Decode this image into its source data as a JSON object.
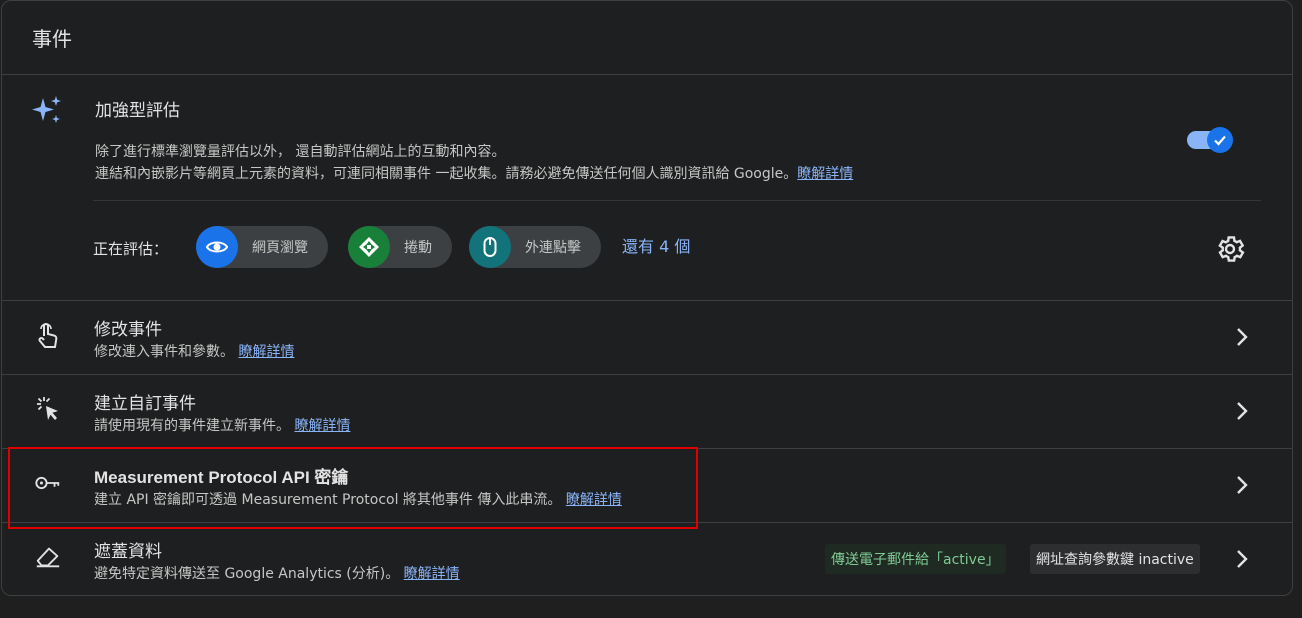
{
  "header": {
    "title": "事件"
  },
  "enhanced": {
    "title": "加強型評估",
    "desc_line1": "除了進行標準瀏覽量評估以外， 還自動評估網站上的互動和內容。",
    "desc_line2": "連結和內嵌影片等網頁上元素的資料，可連同相關事件 一起收集。請務必避免傳送任何個人識別資訊給 Google。",
    "learn_more": "瞭解詳情",
    "toggle_on": true,
    "evaluating_label": "正在評估：",
    "chips": [
      {
        "label": "網頁瀏覽",
        "icon": "eye-icon",
        "color": "#1a73e8"
      },
      {
        "label": "捲動",
        "icon": "scroll-arrows-icon",
        "color": "#188038"
      },
      {
        "label": "外連點擊",
        "icon": "mouse-icon",
        "color": "#12737a"
      }
    ],
    "more_link": "還有 4 個"
  },
  "rows": [
    {
      "title": "修改事件",
      "desc": "修改連入事件和參數。",
      "link": "瞭解詳情",
      "icon": "touch-hand-icon"
    },
    {
      "title": "建立自訂事件",
      "desc": "請使用現有的事件建立新事件。",
      "link": "瞭解詳情",
      "icon": "click-cursor-icon"
    },
    {
      "title": "Measurement Protocol API 密鑰",
      "desc": "建立 API 密鑰即可透過 Measurement Protocol 將其他事件 傳入此串流。",
      "link": "瞭解詳情",
      "icon": "key-icon"
    },
    {
      "title": "遮蓋資料",
      "desc": "避免特定資料傳送至 Google Analytics (分析)。",
      "link": "瞭解詳情",
      "icon": "eraser-icon"
    }
  ],
  "redaction_badges": {
    "email": "傳送電子郵件給「active」",
    "query": "網址查詢參數鍵 inactive"
  },
  "colors": {
    "accent": "#8ab4f8",
    "highlight_border": "#e00000"
  }
}
